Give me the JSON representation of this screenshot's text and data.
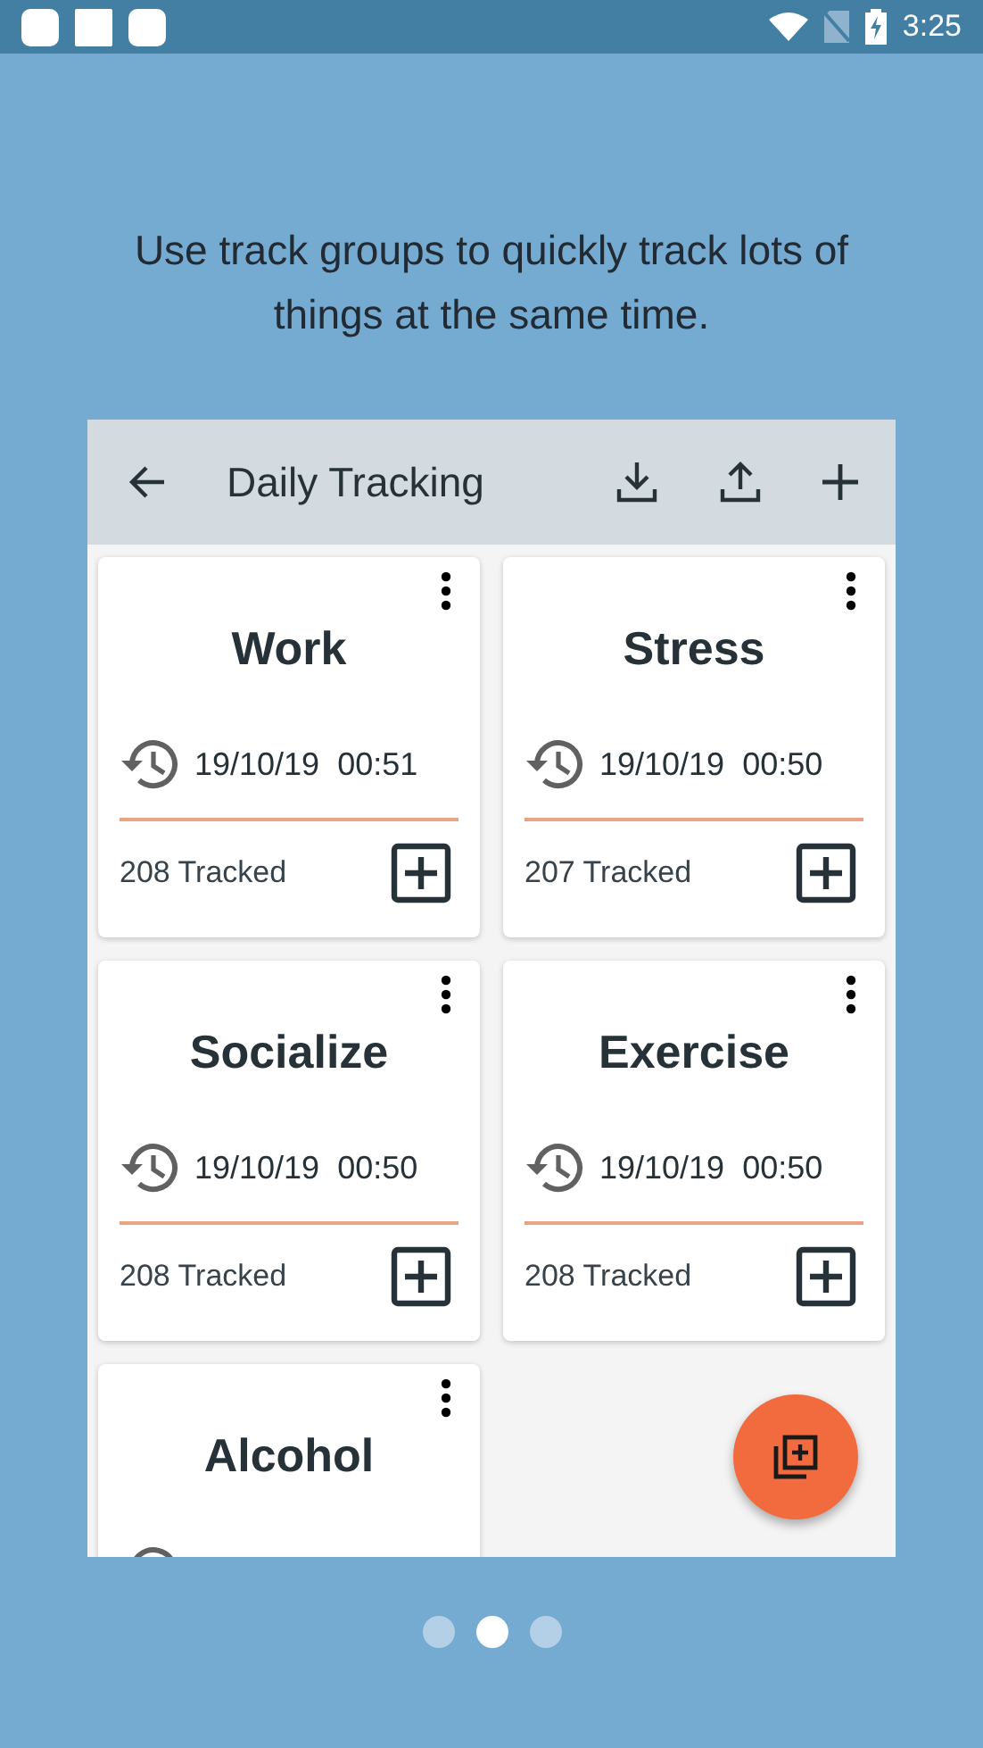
{
  "status_bar": {
    "time": "3:25"
  },
  "caption": "Use track groups to quickly track lots of things at the same time.",
  "screen": {
    "title": "Daily Tracking",
    "groups": [
      {
        "name": "Work",
        "last_tracked": "19/10/19  00:51",
        "count": "208 Tracked"
      },
      {
        "name": "Stress",
        "last_tracked": "19/10/19  00:50",
        "count": "207 Tracked"
      },
      {
        "name": "Socialize",
        "last_tracked": "19/10/19  00:50",
        "count": "208 Tracked"
      },
      {
        "name": "Exercise",
        "last_tracked": "19/10/19  00:50",
        "count": "208 Tracked"
      },
      {
        "name": "Alcohol"
      }
    ]
  },
  "pager": [
    {
      "selected": false
    },
    {
      "selected": true
    },
    {
      "selected": false
    }
  ]
}
